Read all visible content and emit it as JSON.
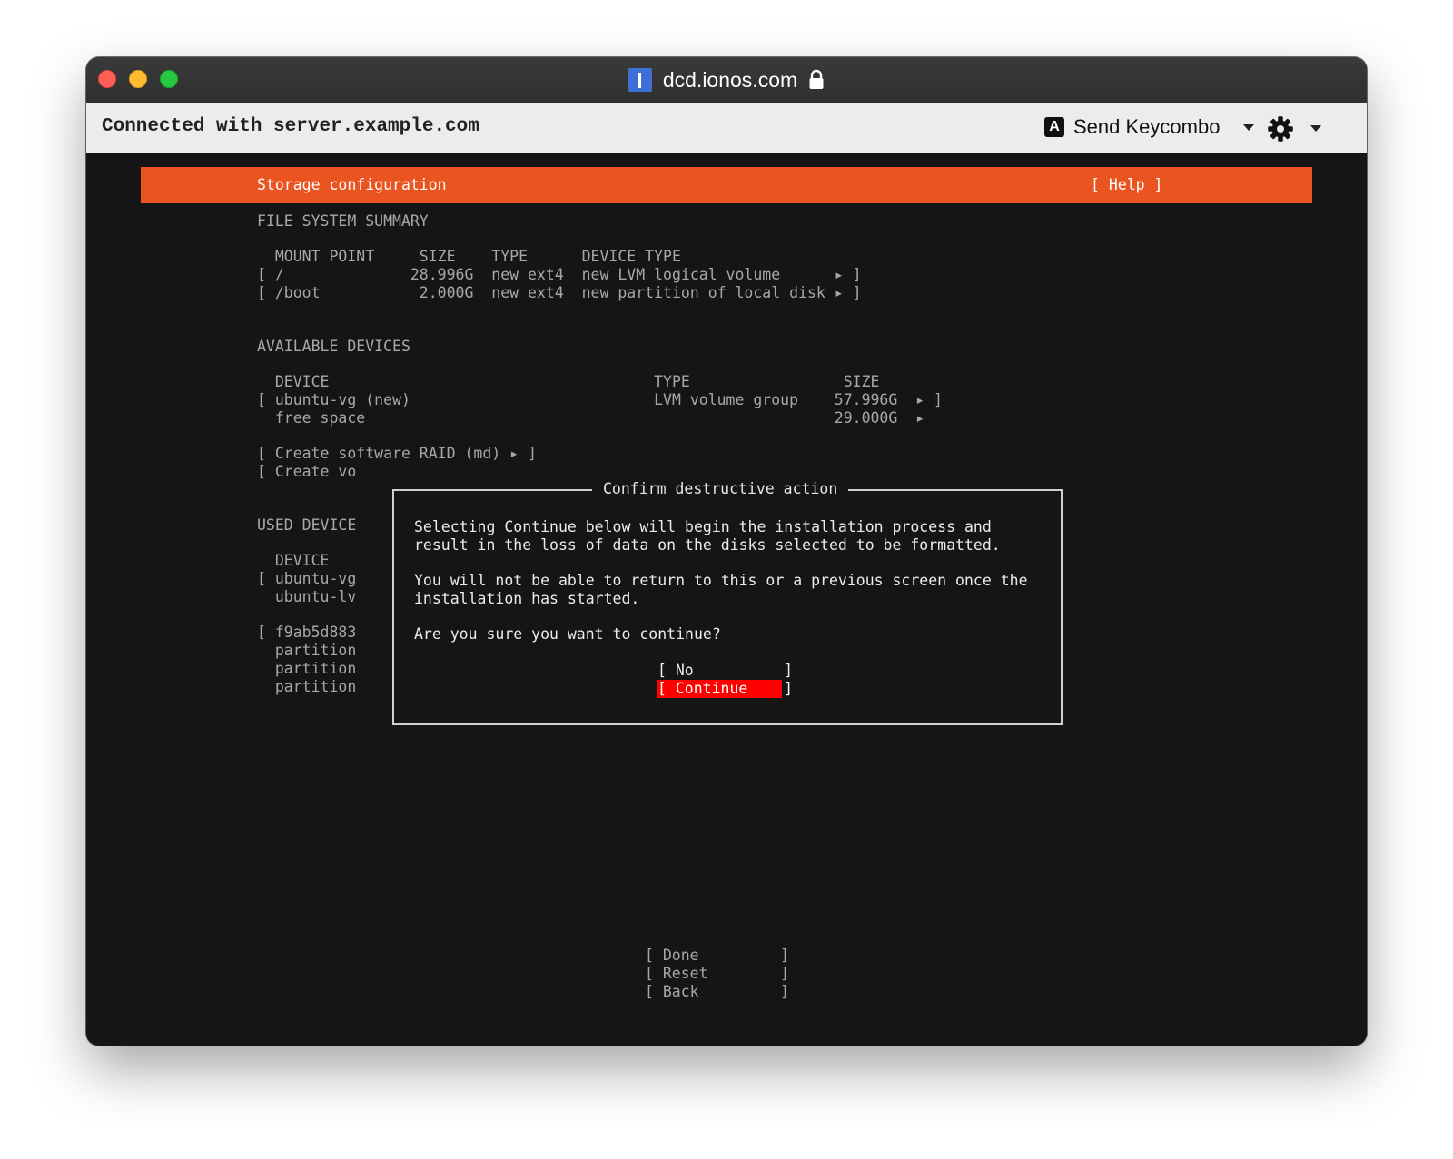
{
  "window": {
    "title": "dcd.ionos.com",
    "site_icon_letter": "I",
    "connected_text": "Connected with server.example.com",
    "send_keycombo_icon_letter": "A",
    "send_keycombo_label": "Send Keycombo"
  },
  "terminal": {
    "header": {
      "title": "Storage configuration",
      "help": "[ Help ]"
    },
    "fs_summary": {
      "heading": "FILE SYSTEM SUMMARY",
      "columns": "  MOUNT POINT     SIZE    TYPE      DEVICE TYPE",
      "rows": [
        "[ /              28.996G  new ext4  new LVM logical volume      ▸ ]",
        "[ /boot           2.000G  new ext4  new partition of local disk ▸ ]"
      ]
    },
    "available": {
      "heading": "AVAILABLE DEVICES",
      "columns": "  DEVICE                                    TYPE                 SIZE",
      "rows": [
        "[ ubuntu-vg (new)                           LVM volume group    57.996G  ▸ ]",
        "  free space                                                    29.000G  ▸"
      ],
      "actions": [
        "[ Create software RAID (md) ▸ ]",
        "[ Create vo"
      ]
    },
    "used": {
      "heading": "USED DEVICE",
      "lines": [
        "  DEVICE",
        "[ ubuntu-vg",
        "  ubuntu-lv",
        "",
        "[ f9ab5d883",
        "  partition",
        "  partition",
        "  partition"
      ]
    },
    "dialog": {
      "title": "Confirm destructive action",
      "paragraph1": "Selecting Continue below will begin the installation process and\nresult in the loss of data on the disks selected to be formatted.",
      "paragraph2": "You will not be able to return to this or a previous screen once the\ninstallation has started.",
      "question": "Are you sure you want to continue?",
      "no_button": "[ No          ]",
      "continue_button": "[ Continue    ]"
    },
    "footer_buttons": {
      "done": "[ Done         ]",
      "reset": "[ Reset        ]",
      "back": "[ Back         ]"
    }
  },
  "colors": {
    "header_orange": "#e95420",
    "continue_red": "#ff0000",
    "terminal_bg": "#151515"
  }
}
